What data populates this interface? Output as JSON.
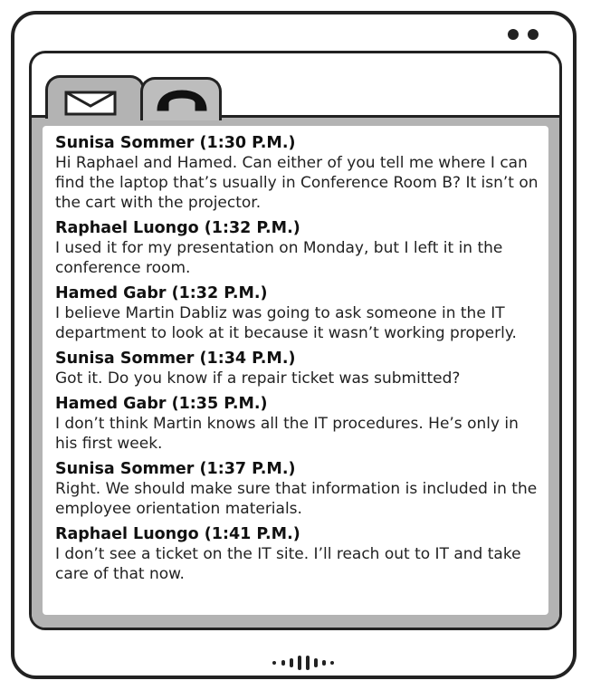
{
  "window": {
    "tabs": [
      {
        "icon": "mail-icon",
        "active": true
      },
      {
        "icon": "phone-icon",
        "active": false
      }
    ]
  },
  "messages": [
    {
      "sender": "Sunisa Sommer",
      "time": "(1:30 P.M.)",
      "text": "Hi Raphael and Hamed. Can either of you tell me where I can find the laptop that’s usually in Conference Room B? It isn’t on the cart with the projector."
    },
    {
      "sender": "Raphael Luongo",
      "time": "(1:32 P.M.)",
      "text": "I used it for my presentation on Monday, but I left it in the conference room."
    },
    {
      "sender": "Hamed Gabr",
      "time": "(1:32 P.M.)",
      "text": "I believe Martin Dabliz was going to ask someone in the IT department to look at it because it wasn’t working properly."
    },
    {
      "sender": "Sunisa Sommer",
      "time": "(1:34 P.M.)",
      "text": "Got it. Do you know if a repair ticket was submitted?"
    },
    {
      "sender": "Hamed Gabr",
      "time": "(1:35 P.M.)",
      "text": "I don’t think Martin knows all the IT procedures. He’s only in his first week."
    },
    {
      "sender": "Sunisa Sommer",
      "time": "(1:37 P.M.)",
      "text": "Right. We should make sure that information is included in the employee orientation materials."
    },
    {
      "sender": "Raphael Luongo",
      "time": "(1:41 P.M.)",
      "text": "I don’t see a ticket on the IT site. I’ll reach out to IT and take care of that now."
    }
  ],
  "colors": {
    "frame": "#222222",
    "tab_gray": "#b3b3b3",
    "background": "#ffffff"
  }
}
